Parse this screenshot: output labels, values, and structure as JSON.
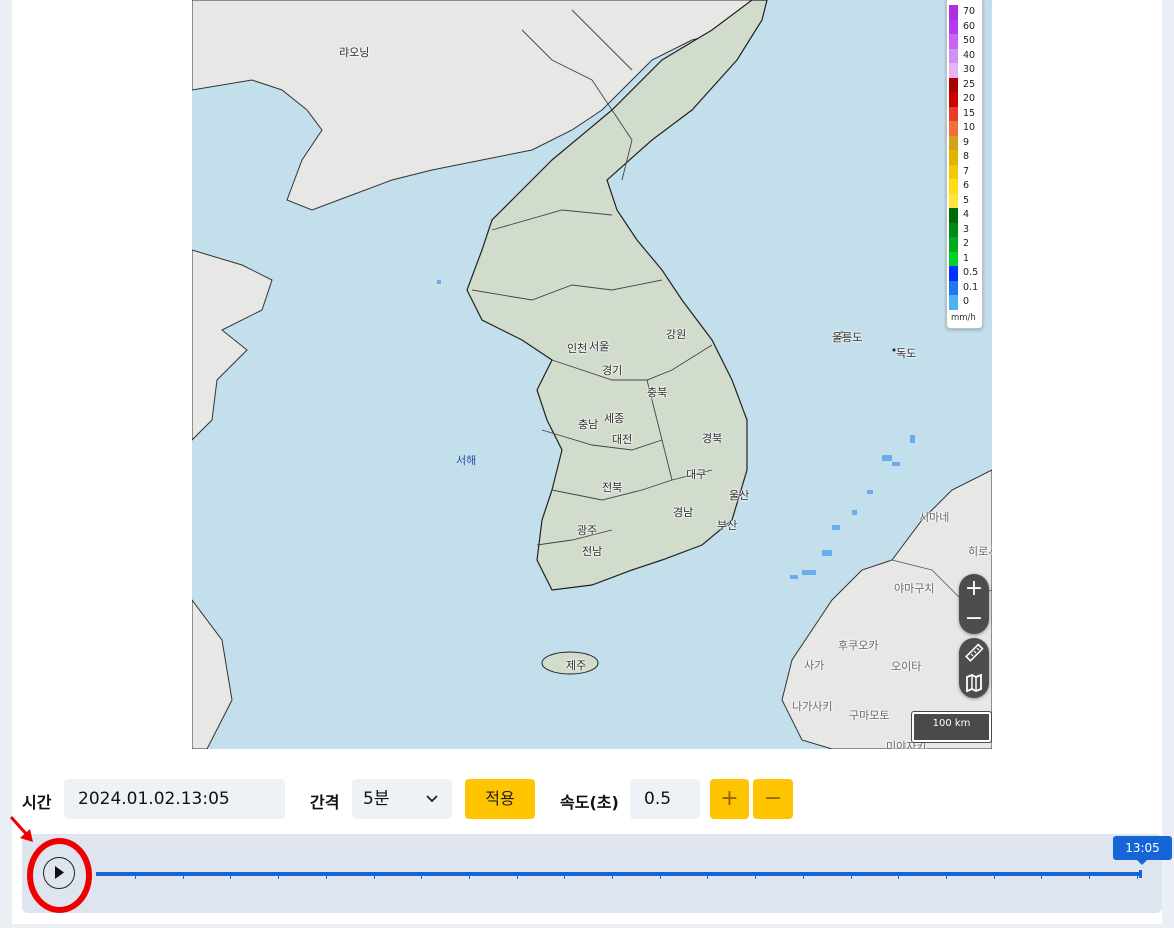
{
  "map": {
    "labels": {
      "liaoning": "랴오닝",
      "gangwon": "강원",
      "ulleungdo": "울릉도",
      "dokdo": "독도",
      "incheon": "인천",
      "seoul": "서울",
      "gyeonggi": "경기",
      "chungbuk": "충북",
      "chungnam": "충남",
      "sejong": "세종",
      "daejeon": "대전",
      "gyeongbuk": "경북",
      "west_sea": "서해",
      "daegu": "대구",
      "jeonbuk": "전북",
      "ulsan": "울산",
      "gyeongnam": "경남",
      "busan": "부산",
      "gwangju": "광주",
      "jeonnam": "전남",
      "jeju": "제주",
      "shimane": "시마네",
      "hiroshima": "히로시",
      "yamaguchi": "야마구치",
      "fukuoka": "후쿠오카",
      "saga": "사가",
      "oita": "오이타",
      "nagasaki": "나가사키",
      "kumamoto": "구마모토",
      "miyazaki": "미야자키"
    },
    "legend": {
      "unit": "mm/h",
      "items": [
        {
          "label": "70",
          "color": "#b02ee0"
        },
        {
          "label": "60",
          "color": "#b43cf0"
        },
        {
          "label": "50",
          "color": "#c864f0"
        },
        {
          "label": "40",
          "color": "#d290f2"
        },
        {
          "label": "30",
          "color": "#e6b4f5"
        },
        {
          "label": "25",
          "color": "#aa0000"
        },
        {
          "label": "20",
          "color": "#cc0000"
        },
        {
          "label": "15",
          "color": "#e83c28"
        },
        {
          "label": "10",
          "color": "#f26e3a"
        },
        {
          "label": "9",
          "color": "#d1a21c"
        },
        {
          "label": "8",
          "color": "#e0b400"
        },
        {
          "label": "7",
          "color": "#f5c800"
        },
        {
          "label": "6",
          "color": "#ffdc14"
        },
        {
          "label": "5",
          "color": "#ffe63c"
        },
        {
          "label": "4",
          "color": "#00690a"
        },
        {
          "label": "3",
          "color": "#008c14"
        },
        {
          "label": "2",
          "color": "#00aa1e"
        },
        {
          "label": "1",
          "color": "#00d028"
        },
        {
          "label": "0.5",
          "color": "#0032ff"
        },
        {
          "label": "0.1",
          "color": "#1e78f0"
        },
        {
          "label": "0",
          "color": "#4ab4f0"
        }
      ]
    },
    "zoom_in": "+",
    "zoom_out": "−",
    "scale_label": "100 km"
  },
  "controls": {
    "time_label": "시간",
    "time_value": "2024.01.02.13:05",
    "interval_label": "간격",
    "interval_value": "5분",
    "apply_label": "적용",
    "speed_label": "속도(초)",
    "speed_value": "0.5",
    "plus_label": "+",
    "minus_label": "−"
  },
  "timeline": {
    "current_time": "13:05"
  }
}
